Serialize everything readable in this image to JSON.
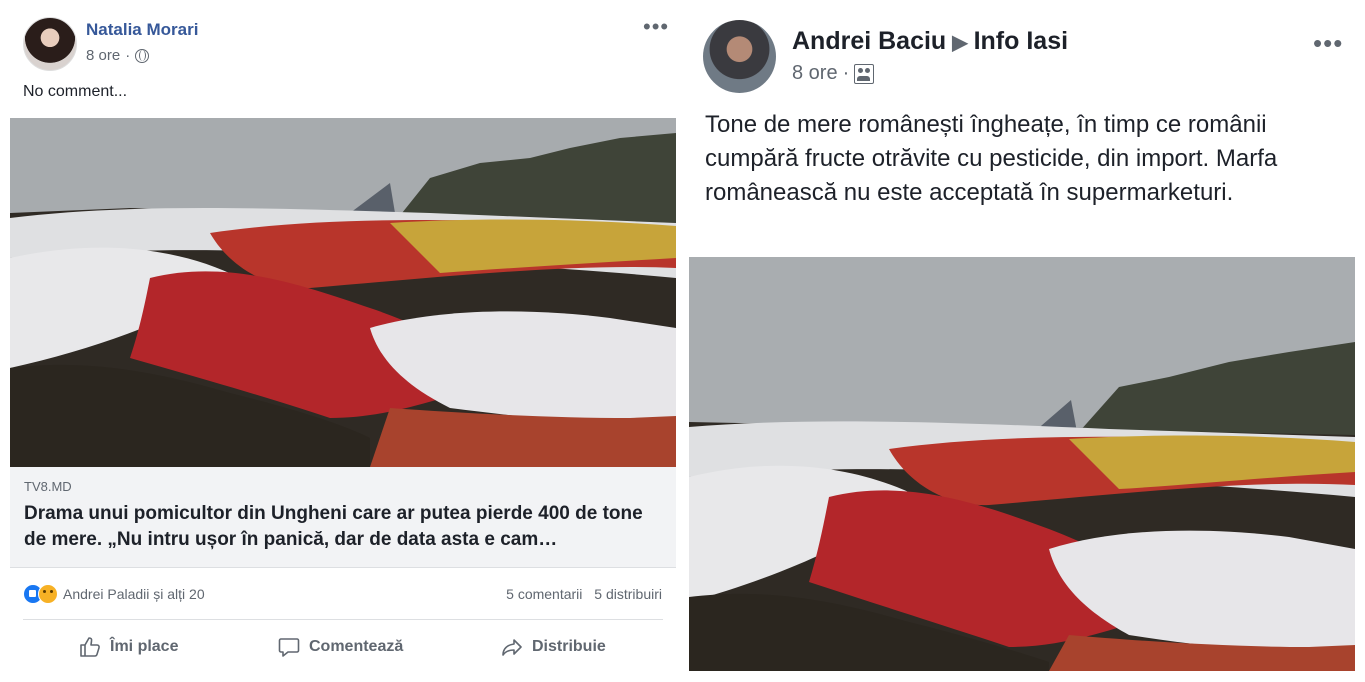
{
  "left_post": {
    "author": "Natalia Morari",
    "time": "8 ore",
    "separator": "·",
    "privacy_icon": "globe-icon",
    "text": "No comment...",
    "link": {
      "domain": "TV8.MD",
      "title": "Drama unui pomicultor din Ungheni care ar putea pierde 400 de tone de mere. „Nu intru ușor în panică, dar de data asta e cam…"
    },
    "reactions_text": "Andrei Paladii și alți 20",
    "comments": "5 comentarii",
    "shares": "5 distribuiri",
    "actions": {
      "like": "Îmi place",
      "comment": "Comentează",
      "share": "Distribuie"
    }
  },
  "right_post": {
    "author": "Andrei Baciu",
    "arrow": "▶",
    "group": "Info Iasi",
    "time": "8 ore",
    "separator": "·",
    "audience_icon": "group-icon",
    "text": "Tone de mere românești îngheațe, în timp ce românii cumpără fructe otrăvite cu pesticide, din import. Marfa românească nu este acceptată în supermarketuri."
  },
  "menu_glyph": "•••",
  "colors": {
    "link_blue": "#365899",
    "text_dark": "#1d2129",
    "meta_gray": "#606770",
    "card_bg": "#f2f3f5"
  }
}
